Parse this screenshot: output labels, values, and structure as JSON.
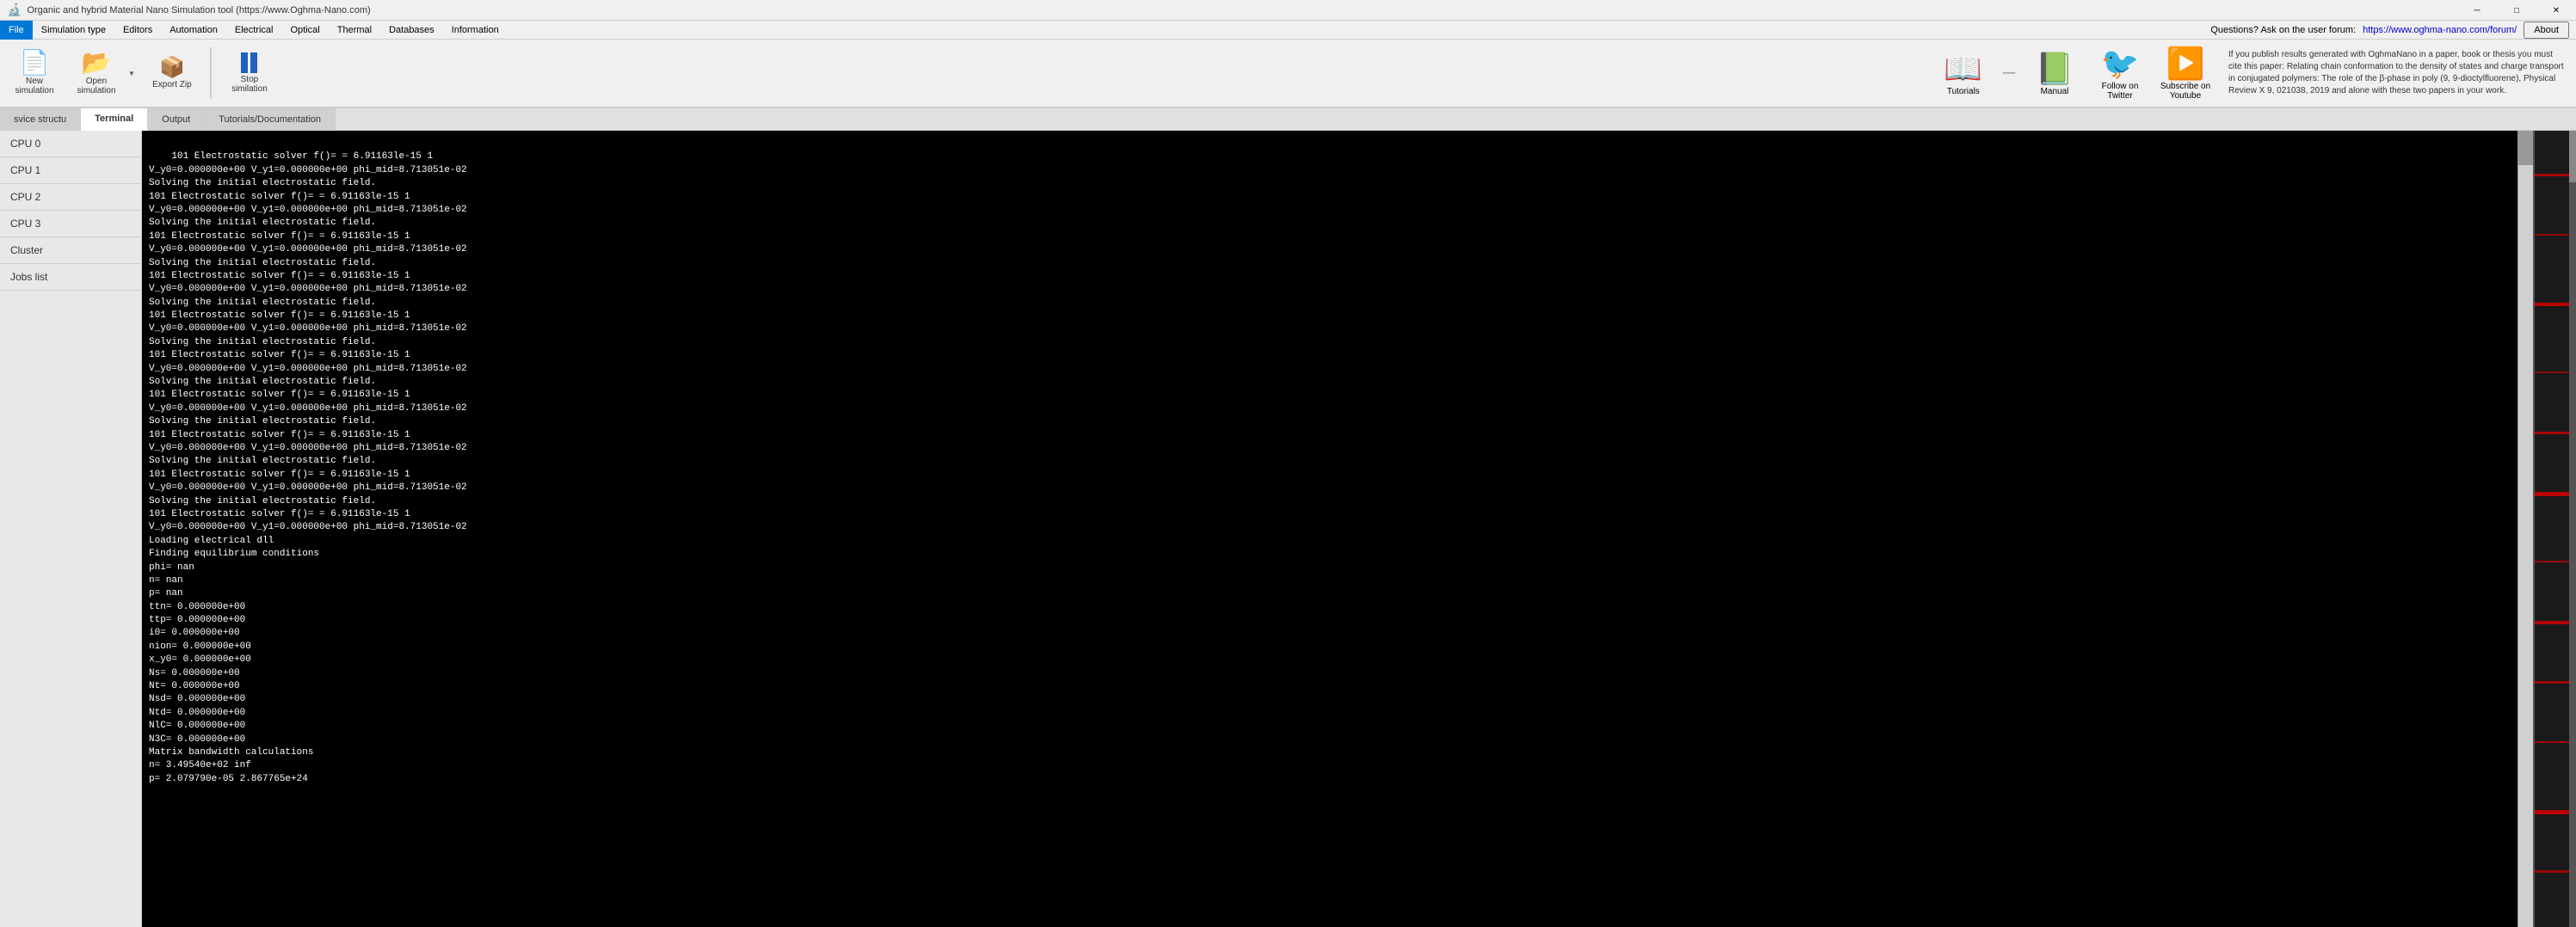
{
  "title_bar": {
    "title": "Organic and hybrid Material Nano Simulation tool (https://www.Oghma-Nano.com)",
    "min_label": "─",
    "max_label": "□",
    "close_label": "✕"
  },
  "menu": {
    "items": [
      "File",
      "Simulation type",
      "Editors",
      "Automation",
      "Electrical",
      "Optical",
      "Thermal",
      "Databases",
      "Information"
    ]
  },
  "toolbar": {
    "new_simulation_label": "New simulation",
    "open_simulation_label": "Open simulation",
    "export_zip_label": "Export Zip",
    "stop_simulation_label": "Stop similation",
    "tutorials_label": "Tutorials",
    "manual_label": "Manual",
    "follow_twitter_label": "Follow on Twitter",
    "subscribe_youtube_label": "Subscribe on Youtube"
  },
  "info_box": {
    "text": "If you publish results generated with OghmaNano in a paper, book or thesis you must cite this paper: Relating chain conformation to the density of states and charge transport in conjugated polymers: The role of the β-phase in poly (9, 9-dioctylfluorene), Physical Review X 9, 021038, 2019 and alone with these two papers in your work."
  },
  "tabs": {
    "items": [
      "svice structu",
      "Terminal",
      "Output",
      "Tutorials/Documentation"
    ],
    "active": "Terminal"
  },
  "sidebar": {
    "items": [
      "CPU 0",
      "CPU 1",
      "CPU 2",
      "CPU 3",
      "Cluster",
      "Jobs list"
    ]
  },
  "terminal": {
    "content": "101 Electrostatic solver f()= = 6.91163le-15 1\nV_y0=0.000000e+00 V_y1=0.000000e+00 phi_mid=8.713051e-02\nSolving the initial electrostatic field.\n101 Electrostatic solver f()= = 6.91163le-15 1\nV_y0=0.000000e+00 V_y1=0.000000e+00 phi_mid=8.713051e-02\nSolving the initial electrostatic field.\n101 Electrostatic solver f()= = 6.91163le-15 1\nV_y0=0.000000e+00 V_y1=0.000000e+00 phi_mid=8.713051e-02\nSolving the initial electrostatic field.\n101 Electrostatic solver f()= = 6.91163le-15 1\nV_y0=0.000000e+00 V_y1=0.000000e+00 phi_mid=8.713051e-02\nSolving the initial electrostatic field.\n101 Electrostatic solver f()= = 6.91163le-15 1\nV_y0=0.000000e+00 V_y1=0.000000e+00 phi_mid=8.713051e-02\nSolving the initial electrostatic field.\n101 Electrostatic solver f()= = 6.91163le-15 1\nV_y0=0.000000e+00 V_y1=0.000000e+00 phi_mid=8.713051e-02\nSolving the initial electrostatic field.\n101 Electrostatic solver f()= = 6.91163le-15 1\nV_y0=0.000000e+00 V_y1=0.000000e+00 phi_mid=8.713051e-02\nSolving the initial electrostatic field.\n101 Electrostatic solver f()= = 6.91163le-15 1\nV_y0=0.000000e+00 V_y1=0.000000e+00 phi_mid=8.713051e-02\nSolving the initial electrostatic field.\n101 Electrostatic solver f()= = 6.91163le-15 1\nV_y0=0.000000e+00 V_y1=0.000000e+00 phi_mid=8.713051e-02\nSolving the initial electrostatic field.\n101 Electrostatic solver f()= = 6.91163le-15 1\nV_y0=0.000000e+00 V_y1=0.000000e+00 phi_mid=8.713051e-02\nLoading electrical dll\nFinding equilibrium conditions\nphi= nan\nn= nan\np= nan\nttn= 0.000000e+00\nttp= 0.000000e+00\ni0= 0.000000e+00\nnion= 0.000000e+00\nx_y0= 0.000000e+00\nNs= 0.000000e+00\nNt= 0.000000e+00\nNsd= 0.000000e+00\nNtd= 0.000000e+00\nNlC= 0.000000e+00\nN3C= 0.000000e+00\nMatrix bandwidth calculations\nn= 3.49540e+02 inf\np= 2.079790e-05 2.867765e+24"
  },
  "about_btn": {
    "label": "About"
  },
  "questions_text": "Questions? Ask on the user forum:",
  "forum_link": "https://www.oghma-nano.com/forum/"
}
